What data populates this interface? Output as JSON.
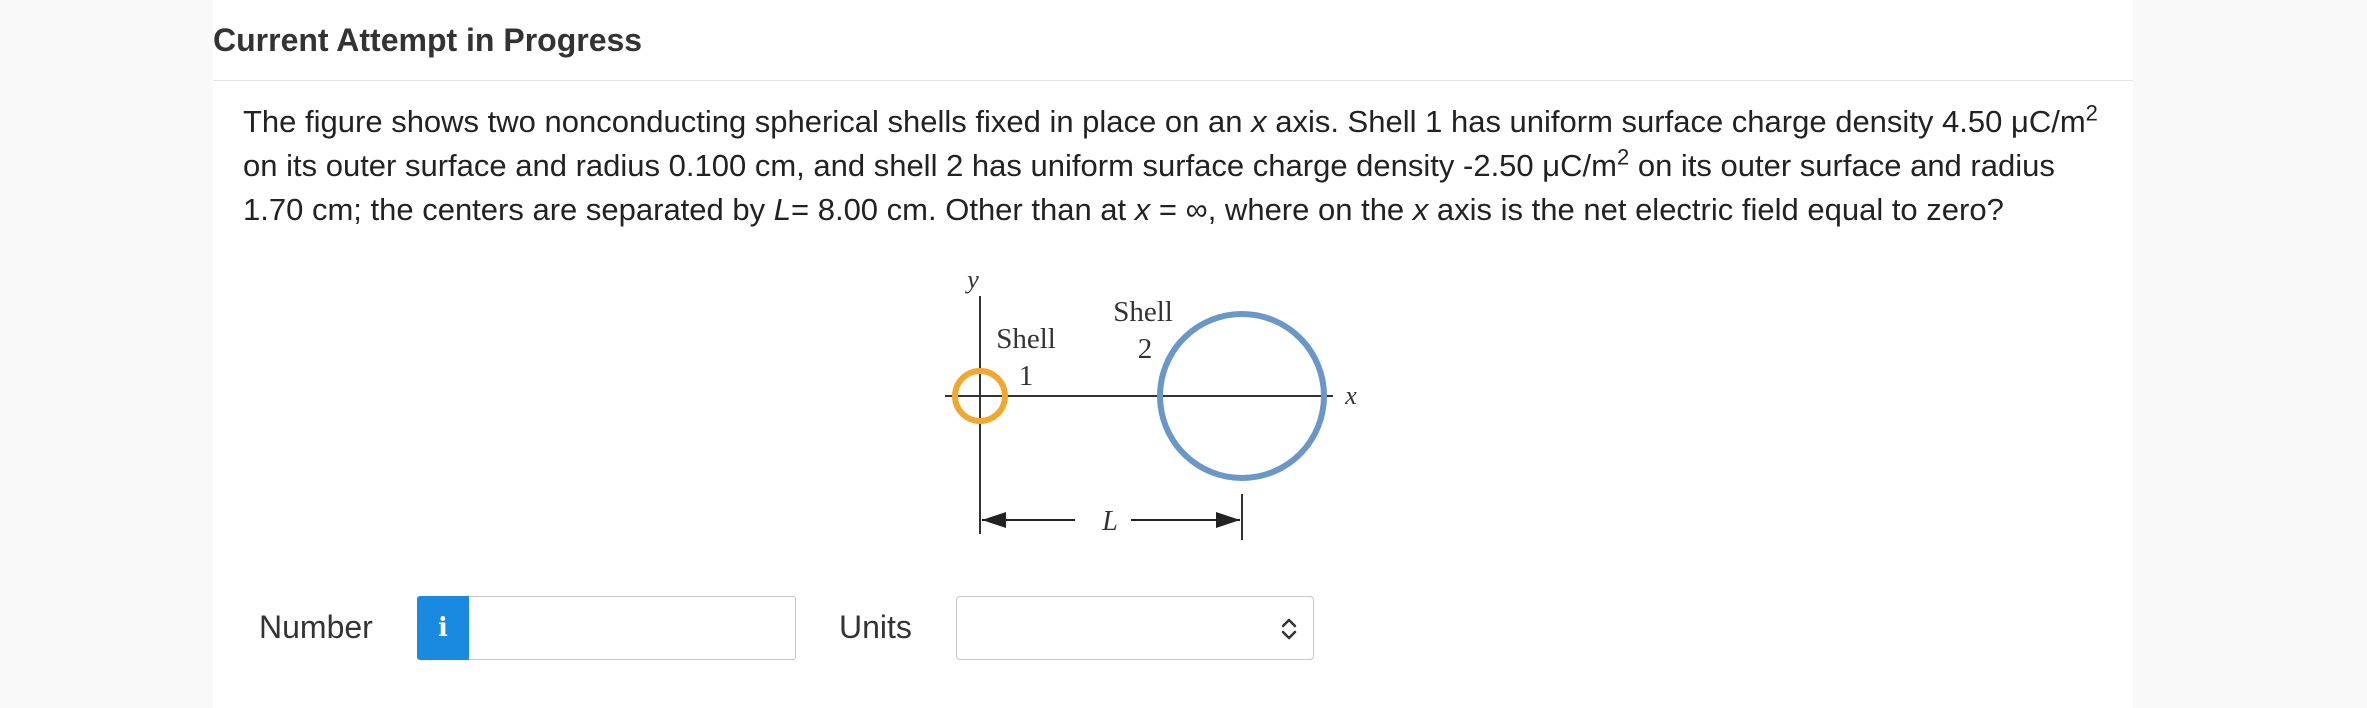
{
  "header": {
    "title": "Current Attempt in Progress"
  },
  "question": {
    "s1": "The figure shows two nonconducting spherical shells fixed in place on an ",
    "x1": "x",
    "s2": " axis. Shell 1 has uniform surface charge density 4.50 μC/m",
    "sup1": "2",
    "s3": " on its outer surface and radius 0.100 cm, and shell 2 has uniform surface charge density -2.50 μC/m",
    "sup2": "2",
    "s4": " on its outer surface and radius 1.70 cm; the centers are separated by ",
    "L": "L",
    "s5": "= 8.00 cm. Other than at ",
    "x2": "x",
    "s6": " = ∞, where on the ",
    "x3": "x",
    "s7": " axis is the net electric field equal to zero?"
  },
  "figure": {
    "y_label": "y",
    "x_label": "x",
    "shell1_word": "Shell",
    "shell1_num": "1",
    "shell2_word": "Shell",
    "shell2_num": "2",
    "distance_label": "L",
    "colors": {
      "shell1": "#f0a830",
      "shell2": "#6b97c8"
    }
  },
  "answer": {
    "number_label": "Number",
    "info_icon_glyph": "i",
    "number_value": "",
    "units_label": "Units",
    "units_selected": ""
  },
  "colors": {
    "accent": "#1a89e0"
  }
}
